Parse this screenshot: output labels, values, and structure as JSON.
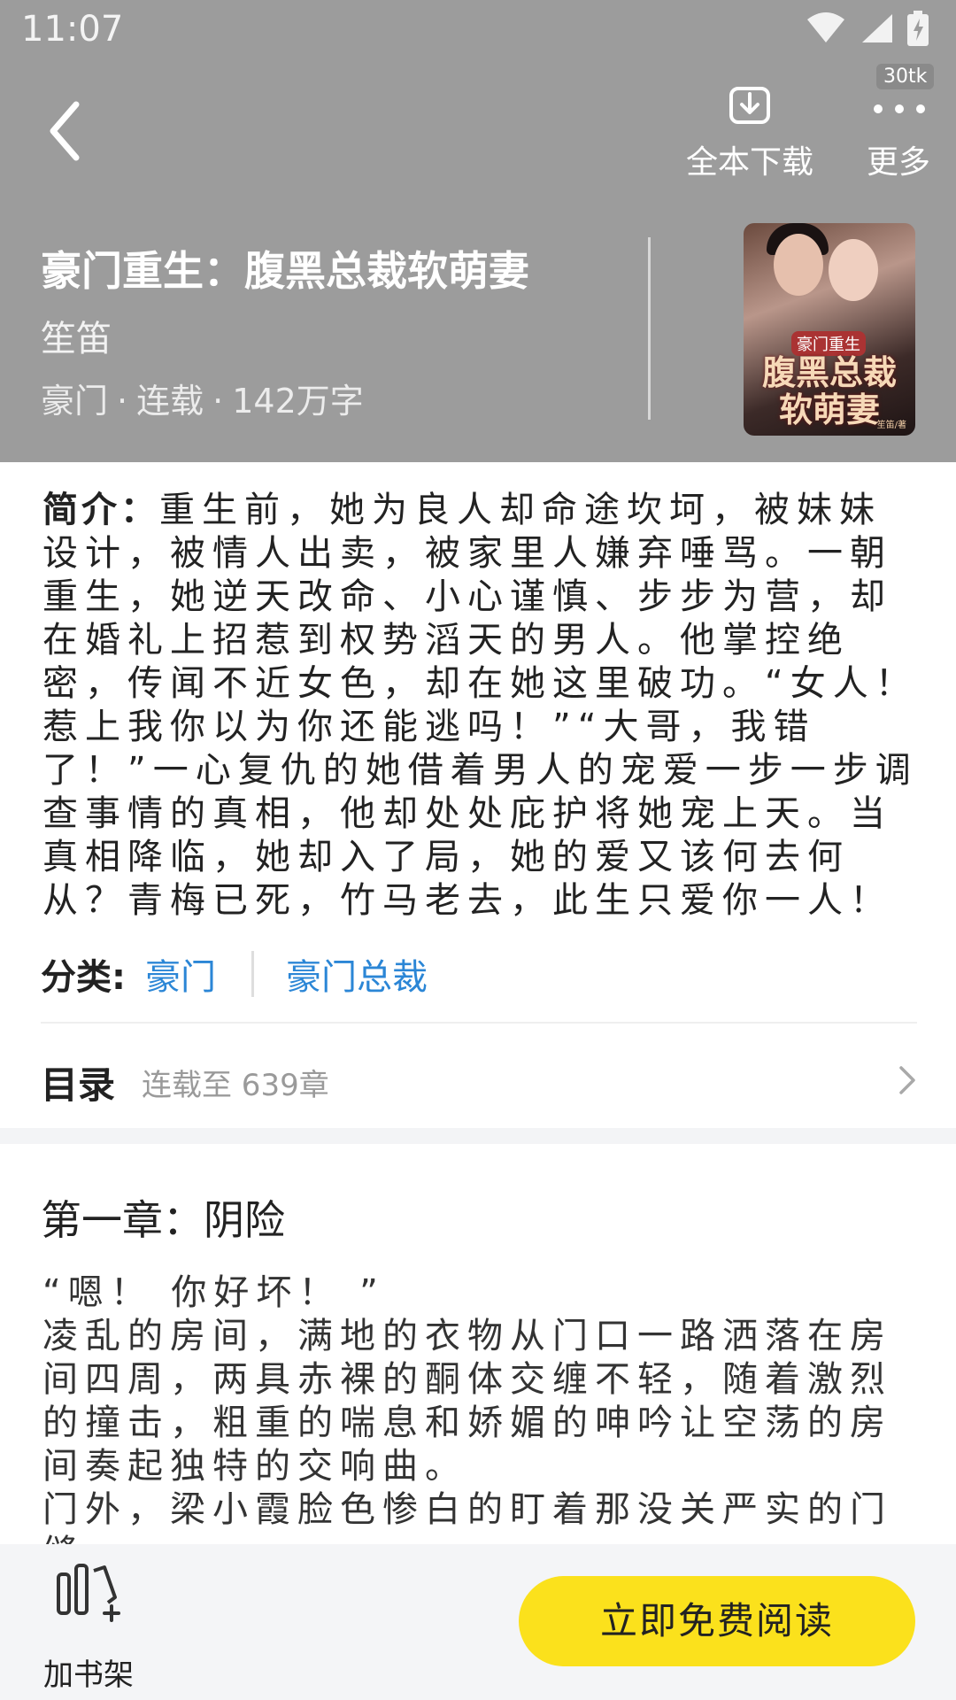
{
  "status_bar": {
    "time": "11:07"
  },
  "header": {
    "download_label": "全本下载",
    "more_label": "更多",
    "more_badge": "30tk"
  },
  "book": {
    "title": "豪门重生：腹黑总裁软萌妻",
    "author": "笙笛",
    "genre": "豪门",
    "status": "连载",
    "word_count": "142万字",
    "cover": {
      "tag": "豪门重生",
      "title": "腹黑总裁软萌妻",
      "author_mini": "笙笛/著"
    }
  },
  "summary": {
    "label": "简介：",
    "text": "重生前，她为良人却命途坎坷，被妹妹设计，被情人出卖，被家里人嫌弃唾骂。一朝重生，她逆天改命、小心谨慎、步步为营，却在婚礼上招惹到权势滔天的男人。他掌控绝密，传闻不近女色，却在她这里破功。“女人！惹上我你以为你还能逃吗！”“大哥，我错了！”一心复仇的她借着男人的宠爱一步一步调查事情的真相，他却处处庇护将她宠上天。当真相降临，她却入了局，她的爱又该何去何从？青梅已死，竹马老去，此生只爱你一人！"
  },
  "category": {
    "label": "分类:",
    "tags": [
      "豪门",
      "豪门总裁"
    ]
  },
  "toc": {
    "label": "目录",
    "status": "连载至 639章"
  },
  "chapter": {
    "title": "第一章：阴险",
    "paragraphs": [
      "“嗯！ 你好坏！ ”",
      "凌乱的房间，满地的衣物从门口一路洒落在房间四周，两具赤裸的酮体交缠不轻，随着激烈的撞击，粗重的喘息和娇媚的呻吟让空荡的房间奏起独特的交响曲。",
      "门外，梁小霞脸色惨白的盯着那没关严实的门缝，"
    ]
  },
  "bottom_bar": {
    "shelf_label": "加书架",
    "read_label": "立即免费阅读"
  }
}
